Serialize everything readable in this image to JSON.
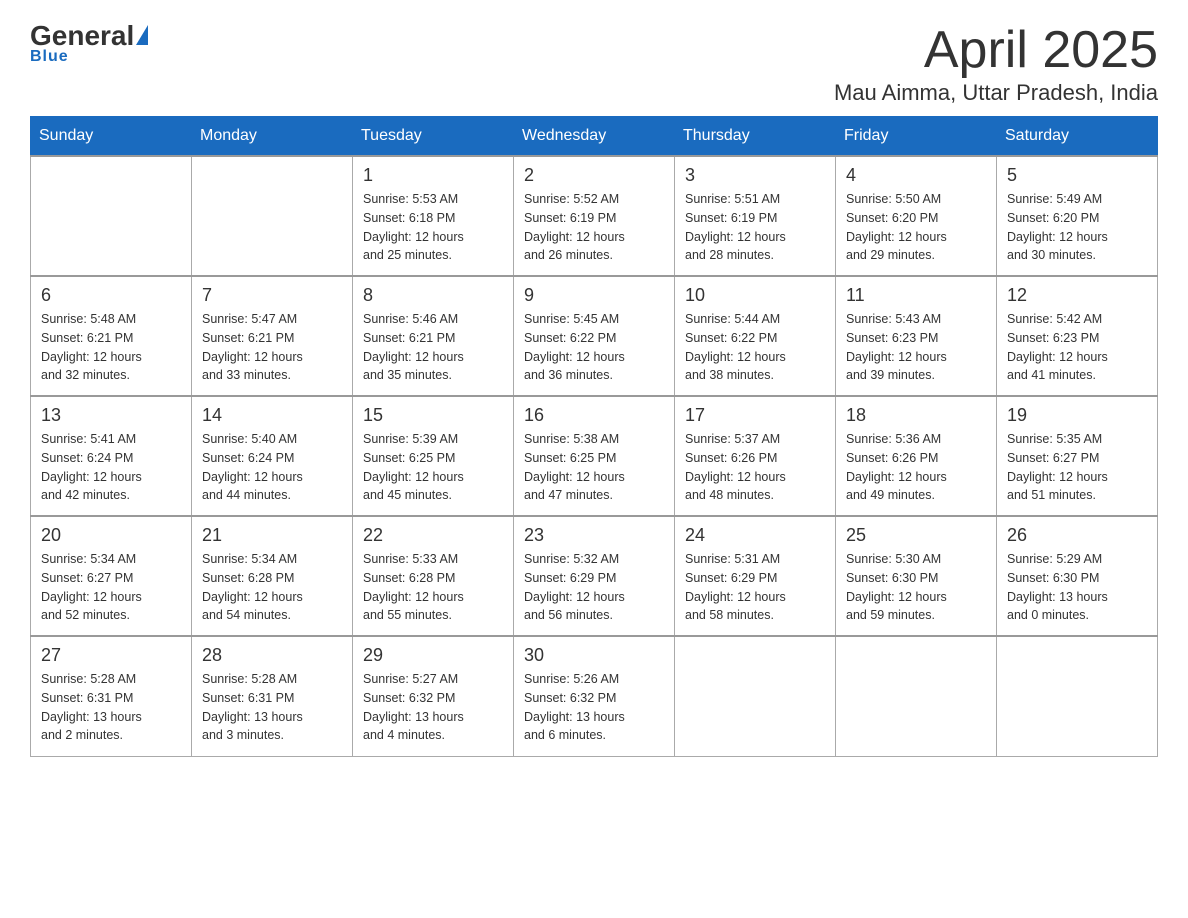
{
  "header": {
    "logo_general": "General",
    "logo_blue": "Blue",
    "title": "April 2025",
    "location": "Mau Aimma, Uttar Pradesh, India"
  },
  "days_of_week": [
    "Sunday",
    "Monday",
    "Tuesday",
    "Wednesday",
    "Thursday",
    "Friday",
    "Saturday"
  ],
  "weeks": [
    [
      {
        "day": "",
        "info": ""
      },
      {
        "day": "",
        "info": ""
      },
      {
        "day": "1",
        "info": "Sunrise: 5:53 AM\nSunset: 6:18 PM\nDaylight: 12 hours\nand 25 minutes."
      },
      {
        "day": "2",
        "info": "Sunrise: 5:52 AM\nSunset: 6:19 PM\nDaylight: 12 hours\nand 26 minutes."
      },
      {
        "day": "3",
        "info": "Sunrise: 5:51 AM\nSunset: 6:19 PM\nDaylight: 12 hours\nand 28 minutes."
      },
      {
        "day": "4",
        "info": "Sunrise: 5:50 AM\nSunset: 6:20 PM\nDaylight: 12 hours\nand 29 minutes."
      },
      {
        "day": "5",
        "info": "Sunrise: 5:49 AM\nSunset: 6:20 PM\nDaylight: 12 hours\nand 30 minutes."
      }
    ],
    [
      {
        "day": "6",
        "info": "Sunrise: 5:48 AM\nSunset: 6:21 PM\nDaylight: 12 hours\nand 32 minutes."
      },
      {
        "day": "7",
        "info": "Sunrise: 5:47 AM\nSunset: 6:21 PM\nDaylight: 12 hours\nand 33 minutes."
      },
      {
        "day": "8",
        "info": "Sunrise: 5:46 AM\nSunset: 6:21 PM\nDaylight: 12 hours\nand 35 minutes."
      },
      {
        "day": "9",
        "info": "Sunrise: 5:45 AM\nSunset: 6:22 PM\nDaylight: 12 hours\nand 36 minutes."
      },
      {
        "day": "10",
        "info": "Sunrise: 5:44 AM\nSunset: 6:22 PM\nDaylight: 12 hours\nand 38 minutes."
      },
      {
        "day": "11",
        "info": "Sunrise: 5:43 AM\nSunset: 6:23 PM\nDaylight: 12 hours\nand 39 minutes."
      },
      {
        "day": "12",
        "info": "Sunrise: 5:42 AM\nSunset: 6:23 PM\nDaylight: 12 hours\nand 41 minutes."
      }
    ],
    [
      {
        "day": "13",
        "info": "Sunrise: 5:41 AM\nSunset: 6:24 PM\nDaylight: 12 hours\nand 42 minutes."
      },
      {
        "day": "14",
        "info": "Sunrise: 5:40 AM\nSunset: 6:24 PM\nDaylight: 12 hours\nand 44 minutes."
      },
      {
        "day": "15",
        "info": "Sunrise: 5:39 AM\nSunset: 6:25 PM\nDaylight: 12 hours\nand 45 minutes."
      },
      {
        "day": "16",
        "info": "Sunrise: 5:38 AM\nSunset: 6:25 PM\nDaylight: 12 hours\nand 47 minutes."
      },
      {
        "day": "17",
        "info": "Sunrise: 5:37 AM\nSunset: 6:26 PM\nDaylight: 12 hours\nand 48 minutes."
      },
      {
        "day": "18",
        "info": "Sunrise: 5:36 AM\nSunset: 6:26 PM\nDaylight: 12 hours\nand 49 minutes."
      },
      {
        "day": "19",
        "info": "Sunrise: 5:35 AM\nSunset: 6:27 PM\nDaylight: 12 hours\nand 51 minutes."
      }
    ],
    [
      {
        "day": "20",
        "info": "Sunrise: 5:34 AM\nSunset: 6:27 PM\nDaylight: 12 hours\nand 52 minutes."
      },
      {
        "day": "21",
        "info": "Sunrise: 5:34 AM\nSunset: 6:28 PM\nDaylight: 12 hours\nand 54 minutes."
      },
      {
        "day": "22",
        "info": "Sunrise: 5:33 AM\nSunset: 6:28 PM\nDaylight: 12 hours\nand 55 minutes."
      },
      {
        "day": "23",
        "info": "Sunrise: 5:32 AM\nSunset: 6:29 PM\nDaylight: 12 hours\nand 56 minutes."
      },
      {
        "day": "24",
        "info": "Sunrise: 5:31 AM\nSunset: 6:29 PM\nDaylight: 12 hours\nand 58 minutes."
      },
      {
        "day": "25",
        "info": "Sunrise: 5:30 AM\nSunset: 6:30 PM\nDaylight: 12 hours\nand 59 minutes."
      },
      {
        "day": "26",
        "info": "Sunrise: 5:29 AM\nSunset: 6:30 PM\nDaylight: 13 hours\nand 0 minutes."
      }
    ],
    [
      {
        "day": "27",
        "info": "Sunrise: 5:28 AM\nSunset: 6:31 PM\nDaylight: 13 hours\nand 2 minutes."
      },
      {
        "day": "28",
        "info": "Sunrise: 5:28 AM\nSunset: 6:31 PM\nDaylight: 13 hours\nand 3 minutes."
      },
      {
        "day": "29",
        "info": "Sunrise: 5:27 AM\nSunset: 6:32 PM\nDaylight: 13 hours\nand 4 minutes."
      },
      {
        "day": "30",
        "info": "Sunrise: 5:26 AM\nSunset: 6:32 PM\nDaylight: 13 hours\nand 6 minutes."
      },
      {
        "day": "",
        "info": ""
      },
      {
        "day": "",
        "info": ""
      },
      {
        "day": "",
        "info": ""
      }
    ]
  ]
}
